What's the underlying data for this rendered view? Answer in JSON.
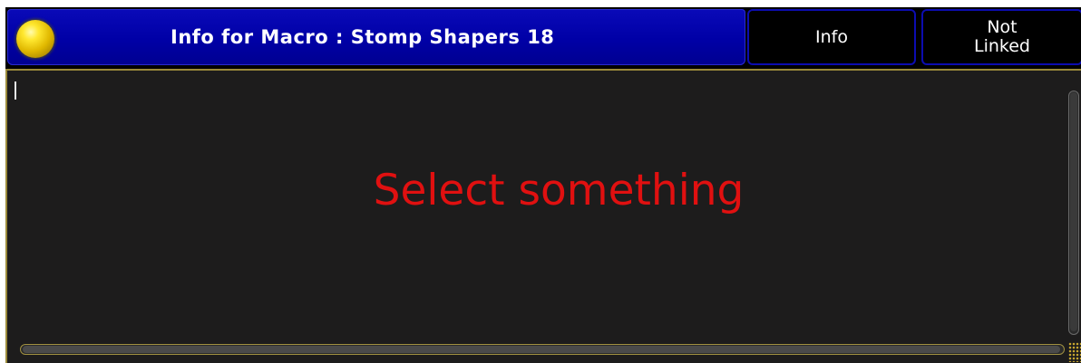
{
  "window": {
    "title": "Info for Macro : Stomp Shapers 18",
    "tabs": [
      {
        "label": "Info"
      },
      {
        "label": "Not\nLinked"
      }
    ]
  },
  "content": {
    "message": "Select something",
    "message_color": "#e01010"
  },
  "icons": {
    "status_ball": "yellow-status-ball-icon",
    "resize": "resize-grip-icon"
  },
  "colors": {
    "title_bar": "#0000a6",
    "content_bg": "#1d1c1c",
    "border_accent": "#9a8a3a"
  }
}
